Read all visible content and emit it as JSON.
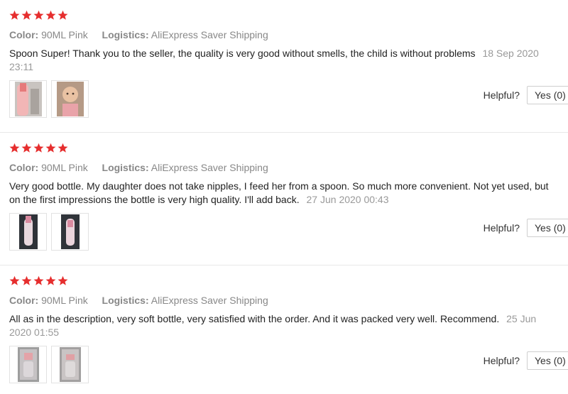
{
  "colors": {
    "star": "#e62e2e",
    "meta": "#888888",
    "date": "#999999"
  },
  "reviews": [
    {
      "rating": 5,
      "color_label": "Color:",
      "color_value": "90ML Pink",
      "logistics_label": "Logistics:",
      "logistics_value": "AliExpress Saver Shipping",
      "text": "Spoon Super! Thank you to the seller, the quality is very good without smells, the child is without problems",
      "date": "18 Sep 2020 23:11",
      "photos": [
        "bottle-photo",
        "baby-photo"
      ],
      "helpful_label": "Helpful?",
      "yes_label": "Yes (0)"
    },
    {
      "rating": 5,
      "color_label": "Color:",
      "color_value": "90ML Pink",
      "logistics_label": "Logistics:",
      "logistics_value": "AliExpress Saver Shipping",
      "text": "Very good bottle. My daughter does not take nipples, I feed her from a spoon. So much more convenient. Not yet used, but on the first impressions the bottle is very high quality. I'll add back.",
      "date": "27 Jun 2020 00:43",
      "photos": [
        "bottle-photo",
        "bottle-photo"
      ],
      "helpful_label": "Helpful?",
      "yes_label": "Yes (0)"
    },
    {
      "rating": 5,
      "color_label": "Color:",
      "color_value": "90ML Pink",
      "logistics_label": "Logistics:",
      "logistics_value": "AliExpress Saver Shipping",
      "text": "All as in the description, very soft bottle, very satisfied with the order. And it was packed very well. Recommend.",
      "date": "25 Jun 2020 01:55",
      "photos": [
        "package-photo",
        "package-photo"
      ],
      "helpful_label": "Helpful?",
      "yes_label": "Yes (0)"
    }
  ]
}
